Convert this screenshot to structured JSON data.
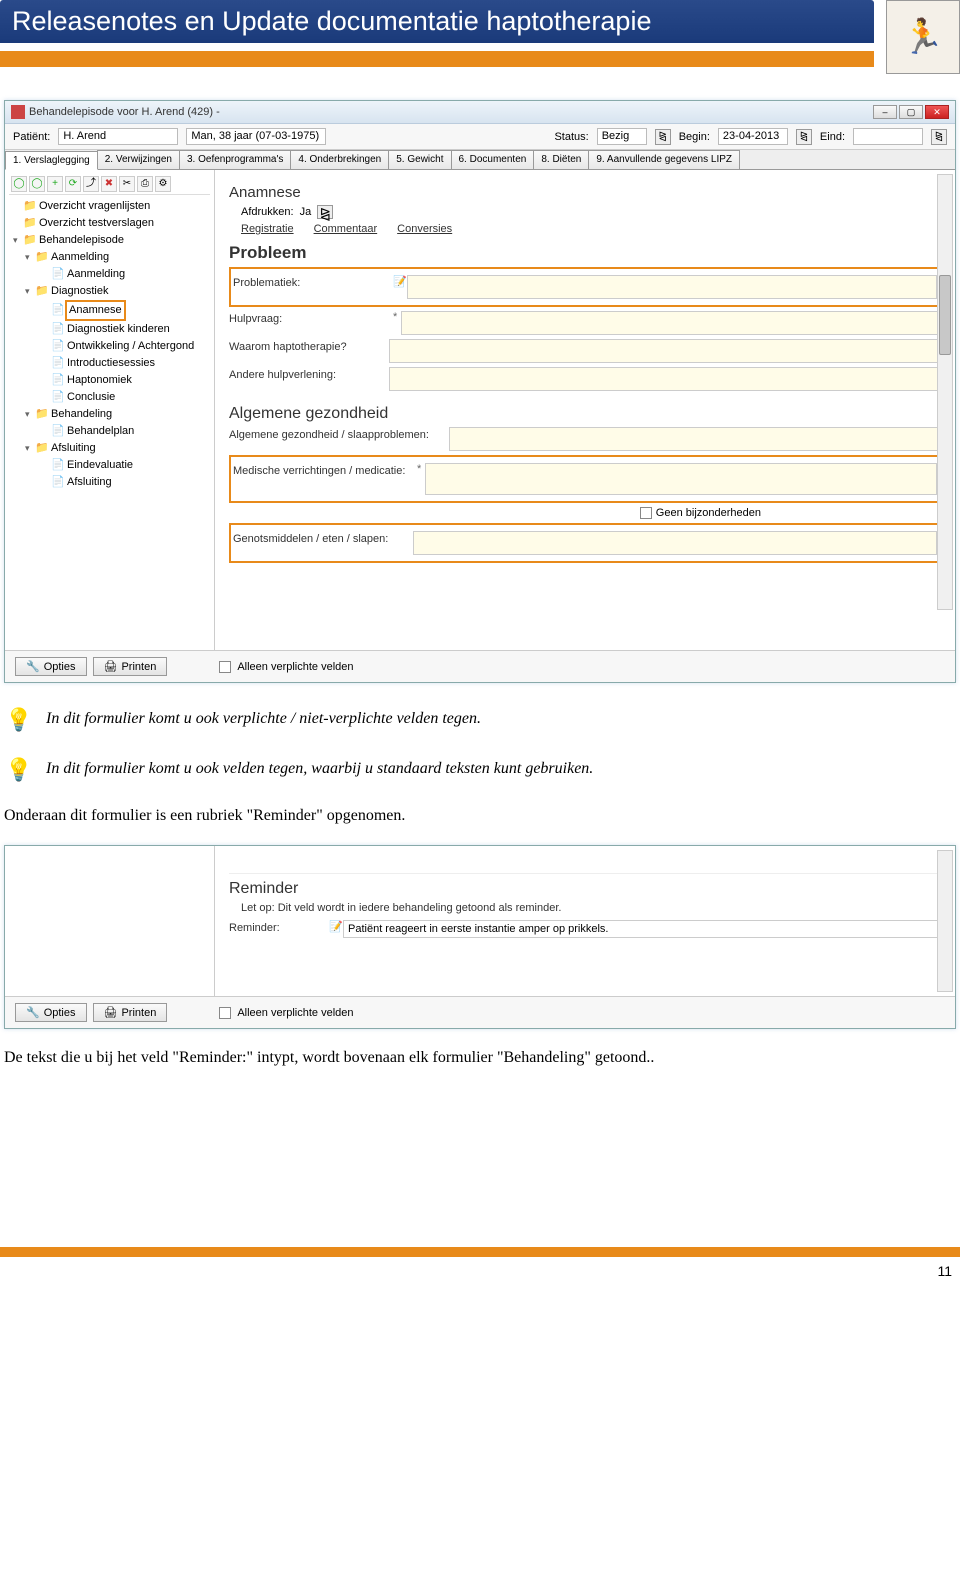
{
  "doc": {
    "title": "Releasenotes en Update documentatie haptotherapie",
    "page_number": "11"
  },
  "logo_glyph": "🏃",
  "window": {
    "title": "Behandelepisode voor H. Arend (429) -",
    "patient_label": "Patiënt:",
    "patient_name": "H. Arend",
    "patient_info": "Man, 38 jaar (07-03-1975)",
    "status_label": "Status:",
    "status_value": "Bezig",
    "begin_label": "Begin:",
    "begin_value": "23-04-2013",
    "end_label": "Eind:"
  },
  "tabs": [
    "1. Verslaglegging",
    "2. Verwijzingen",
    "3. Oefenprogramma's",
    "4. Onderbrekingen",
    "5. Gewicht",
    "6. Documenten",
    "8. Diëten",
    "9. Aanvullende gegevens LIPZ"
  ],
  "toolbar_icons": [
    "◯",
    "◯",
    "+",
    "⟳",
    "⤴",
    "✖",
    "✂",
    "⎙",
    "⚙"
  ],
  "tree": {
    "items": [
      {
        "label": "Overzicht vragenlijsten",
        "lvl": 0,
        "icon": "folder"
      },
      {
        "label": "Overzicht testverslagen",
        "lvl": 0,
        "icon": "folder"
      },
      {
        "label": "Behandelepisode",
        "lvl": 0,
        "icon": "folder",
        "exp": "▾"
      },
      {
        "label": "Aanmelding",
        "lvl": 1,
        "icon": "folder",
        "exp": "▾"
      },
      {
        "label": "Aanmelding",
        "lvl": 2,
        "icon": "doc"
      },
      {
        "label": "Diagnostiek",
        "lvl": 1,
        "icon": "folder",
        "exp": "▾"
      },
      {
        "label": "Anamnese",
        "lvl": 2,
        "icon": "doc",
        "highlight": true
      },
      {
        "label": "Diagnostiek kinderen",
        "lvl": 2,
        "icon": "doc"
      },
      {
        "label": "Ontwikkeling / Achtergond",
        "lvl": 2,
        "icon": "doc"
      },
      {
        "label": "Introductiesessies",
        "lvl": 2,
        "icon": "doc"
      },
      {
        "label": "Haptonomiek",
        "lvl": 2,
        "icon": "doc"
      },
      {
        "label": "Conclusie",
        "lvl": 2,
        "icon": "doc"
      },
      {
        "label": "Behandeling",
        "lvl": 1,
        "icon": "folder",
        "exp": "▾"
      },
      {
        "label": "Behandelplan",
        "lvl": 2,
        "icon": "doc"
      },
      {
        "label": "Afsluiting",
        "lvl": 1,
        "icon": "folder",
        "exp": "▾"
      },
      {
        "label": "Eindevaluatie",
        "lvl": 2,
        "icon": "doc"
      },
      {
        "label": "Afsluiting",
        "lvl": 2,
        "icon": "doc"
      }
    ]
  },
  "form": {
    "section1": "Anamnese",
    "afdruk_label": "Afdrukken:",
    "afdruk_value": "Ja",
    "subtabs": [
      "Registratie",
      "Commentaar",
      "Conversies"
    ],
    "section2": "Probleem",
    "problematiek": "Problematiek:",
    "hulpvraag": "Hulpvraag:",
    "waarom": "Waarom haptotherapie?",
    "andere": "Andere hulpverlening:",
    "section3": "Algemene gezondheid",
    "alg_gez": "Algemene gezondheid / slaapproblemen:",
    "medische": "Medische verrichtingen / medicatie:",
    "geen_bijz": "Geen bijzonderheden",
    "genot": "Genotsmiddelen / eten / slapen:"
  },
  "bottom": {
    "opties": "Opties",
    "printen": "Printen",
    "alleen": "Alleen verplichte velden"
  },
  "notes": {
    "n1": "In dit formulier komt u ook verplichte / niet-verplichte velden tegen.",
    "n2": "In dit formulier komt u ook velden tegen, waarbij u standaard teksten kunt gebruiken.",
    "p1": "Onderaan dit formulier is een rubriek \"Reminder\" opgenomen.",
    "p2": "De tekst die u bij het veld \"Reminder:\" intypt, wordt bovenaan elk formulier \"Behandeling\" getoond.."
  },
  "reminder": {
    "section": "Reminder",
    "note": "Let op: Dit veld wordt in iedere behandeling getoond als reminder.",
    "label": "Reminder:",
    "value": "Patiënt reageert in eerste instantie amper op prikkels."
  }
}
